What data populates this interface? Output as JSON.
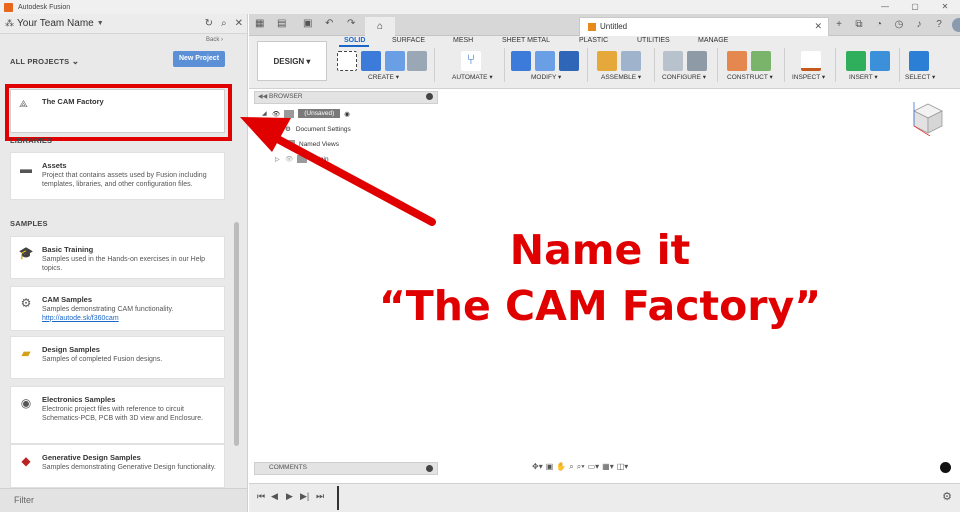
{
  "window": {
    "title": "Autodesk Fusion",
    "controls": [
      "—",
      "▢",
      "✕"
    ]
  },
  "team": {
    "name": "Your Team Name",
    "back": "Back ›"
  },
  "projects": {
    "heading": "ALL PROJECTS",
    "new_project": "New Project",
    "items": [
      {
        "name": "The CAM Factory"
      }
    ]
  },
  "libraries": {
    "heading": "LIBRARIES",
    "items": [
      {
        "name": "Assets",
        "desc": "Project that contains assets used by Fusion including templates, libraries, and other configuration files."
      }
    ]
  },
  "samples": {
    "heading": "SAMPLES",
    "items": [
      {
        "name": "Basic Training",
        "desc": "Samples used in the Hands-on exercises in our Help topics."
      },
      {
        "name": "CAM Samples",
        "desc": "Samples demonstrating CAM functionality.",
        "link": "http://autode.sk/f360cam"
      },
      {
        "name": "Design Samples",
        "desc": "Samples of completed Fusion designs."
      },
      {
        "name": "Electronics Samples",
        "desc": "Electronic project files with reference to circuit Schematics-PCB, PCB with 3D view and Enclosure."
      },
      {
        "name": "Generative Design Samples",
        "desc": "Samples demonstrating Generative Design functionality."
      }
    ]
  },
  "filter": {
    "placeholder": "Filter"
  },
  "document": {
    "name": "Untitled"
  },
  "ribbon": {
    "workspace": "DESIGN ▾",
    "tabs": [
      "SOLID",
      "SURFACE",
      "MESH",
      "SHEET METAL",
      "PLASTIC",
      "UTILITIES",
      "MANAGE"
    ],
    "groups": [
      "CREATE ▾",
      "AUTOMATE ▾",
      "MODIFY ▾",
      "ASSEMBLE ▾",
      "CONFIGURE ▾",
      "CONSTRUCT ▾",
      "INSPECT ▾",
      "INSERT ▾",
      "SELECT ▾"
    ]
  },
  "browser": {
    "heading": "BROWSER",
    "root": "(Unsaved)",
    "nodes": [
      "Document Settings",
      "Named Views",
      "Origin"
    ]
  },
  "comments": {
    "heading": "COMMENTS"
  },
  "annotation": {
    "line1": "Name it",
    "line2": "“The CAM Factory”"
  },
  "colors": {
    "annotation": "#e00000",
    "accent": "#1a66c9",
    "new_project_button": "#5b8fd6"
  }
}
